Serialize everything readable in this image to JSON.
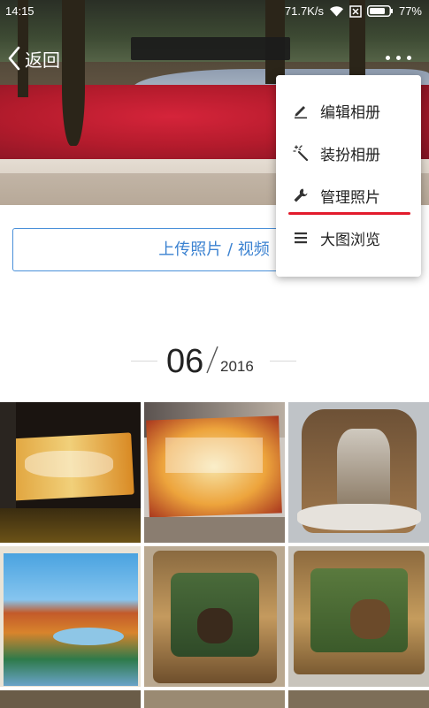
{
  "status_bar": {
    "time": "14:15",
    "network_speed": "71.7K/s",
    "battery": "77%",
    "icons": [
      "wifi-icon",
      "sim-off-icon",
      "battery-icon"
    ]
  },
  "nav": {
    "back_label": "返回",
    "more_icon": "more-dots-icon"
  },
  "menu": {
    "items": [
      {
        "label": "编辑相册",
        "icon": "pencil-icon"
      },
      {
        "label": "装扮相册",
        "icon": "magic-wand-icon"
      },
      {
        "label": "管理照片",
        "icon": "wrench-icon"
      },
      {
        "label": "大图浏览",
        "icon": "list-icon"
      }
    ],
    "highlight_color": "#e21b2c"
  },
  "upload": {
    "label": "上传照片 / 视频"
  },
  "date_group": {
    "month": "06",
    "year": "2016"
  },
  "colors": {
    "accent_blue": "#3b82d1",
    "text_dark": "#222222"
  }
}
